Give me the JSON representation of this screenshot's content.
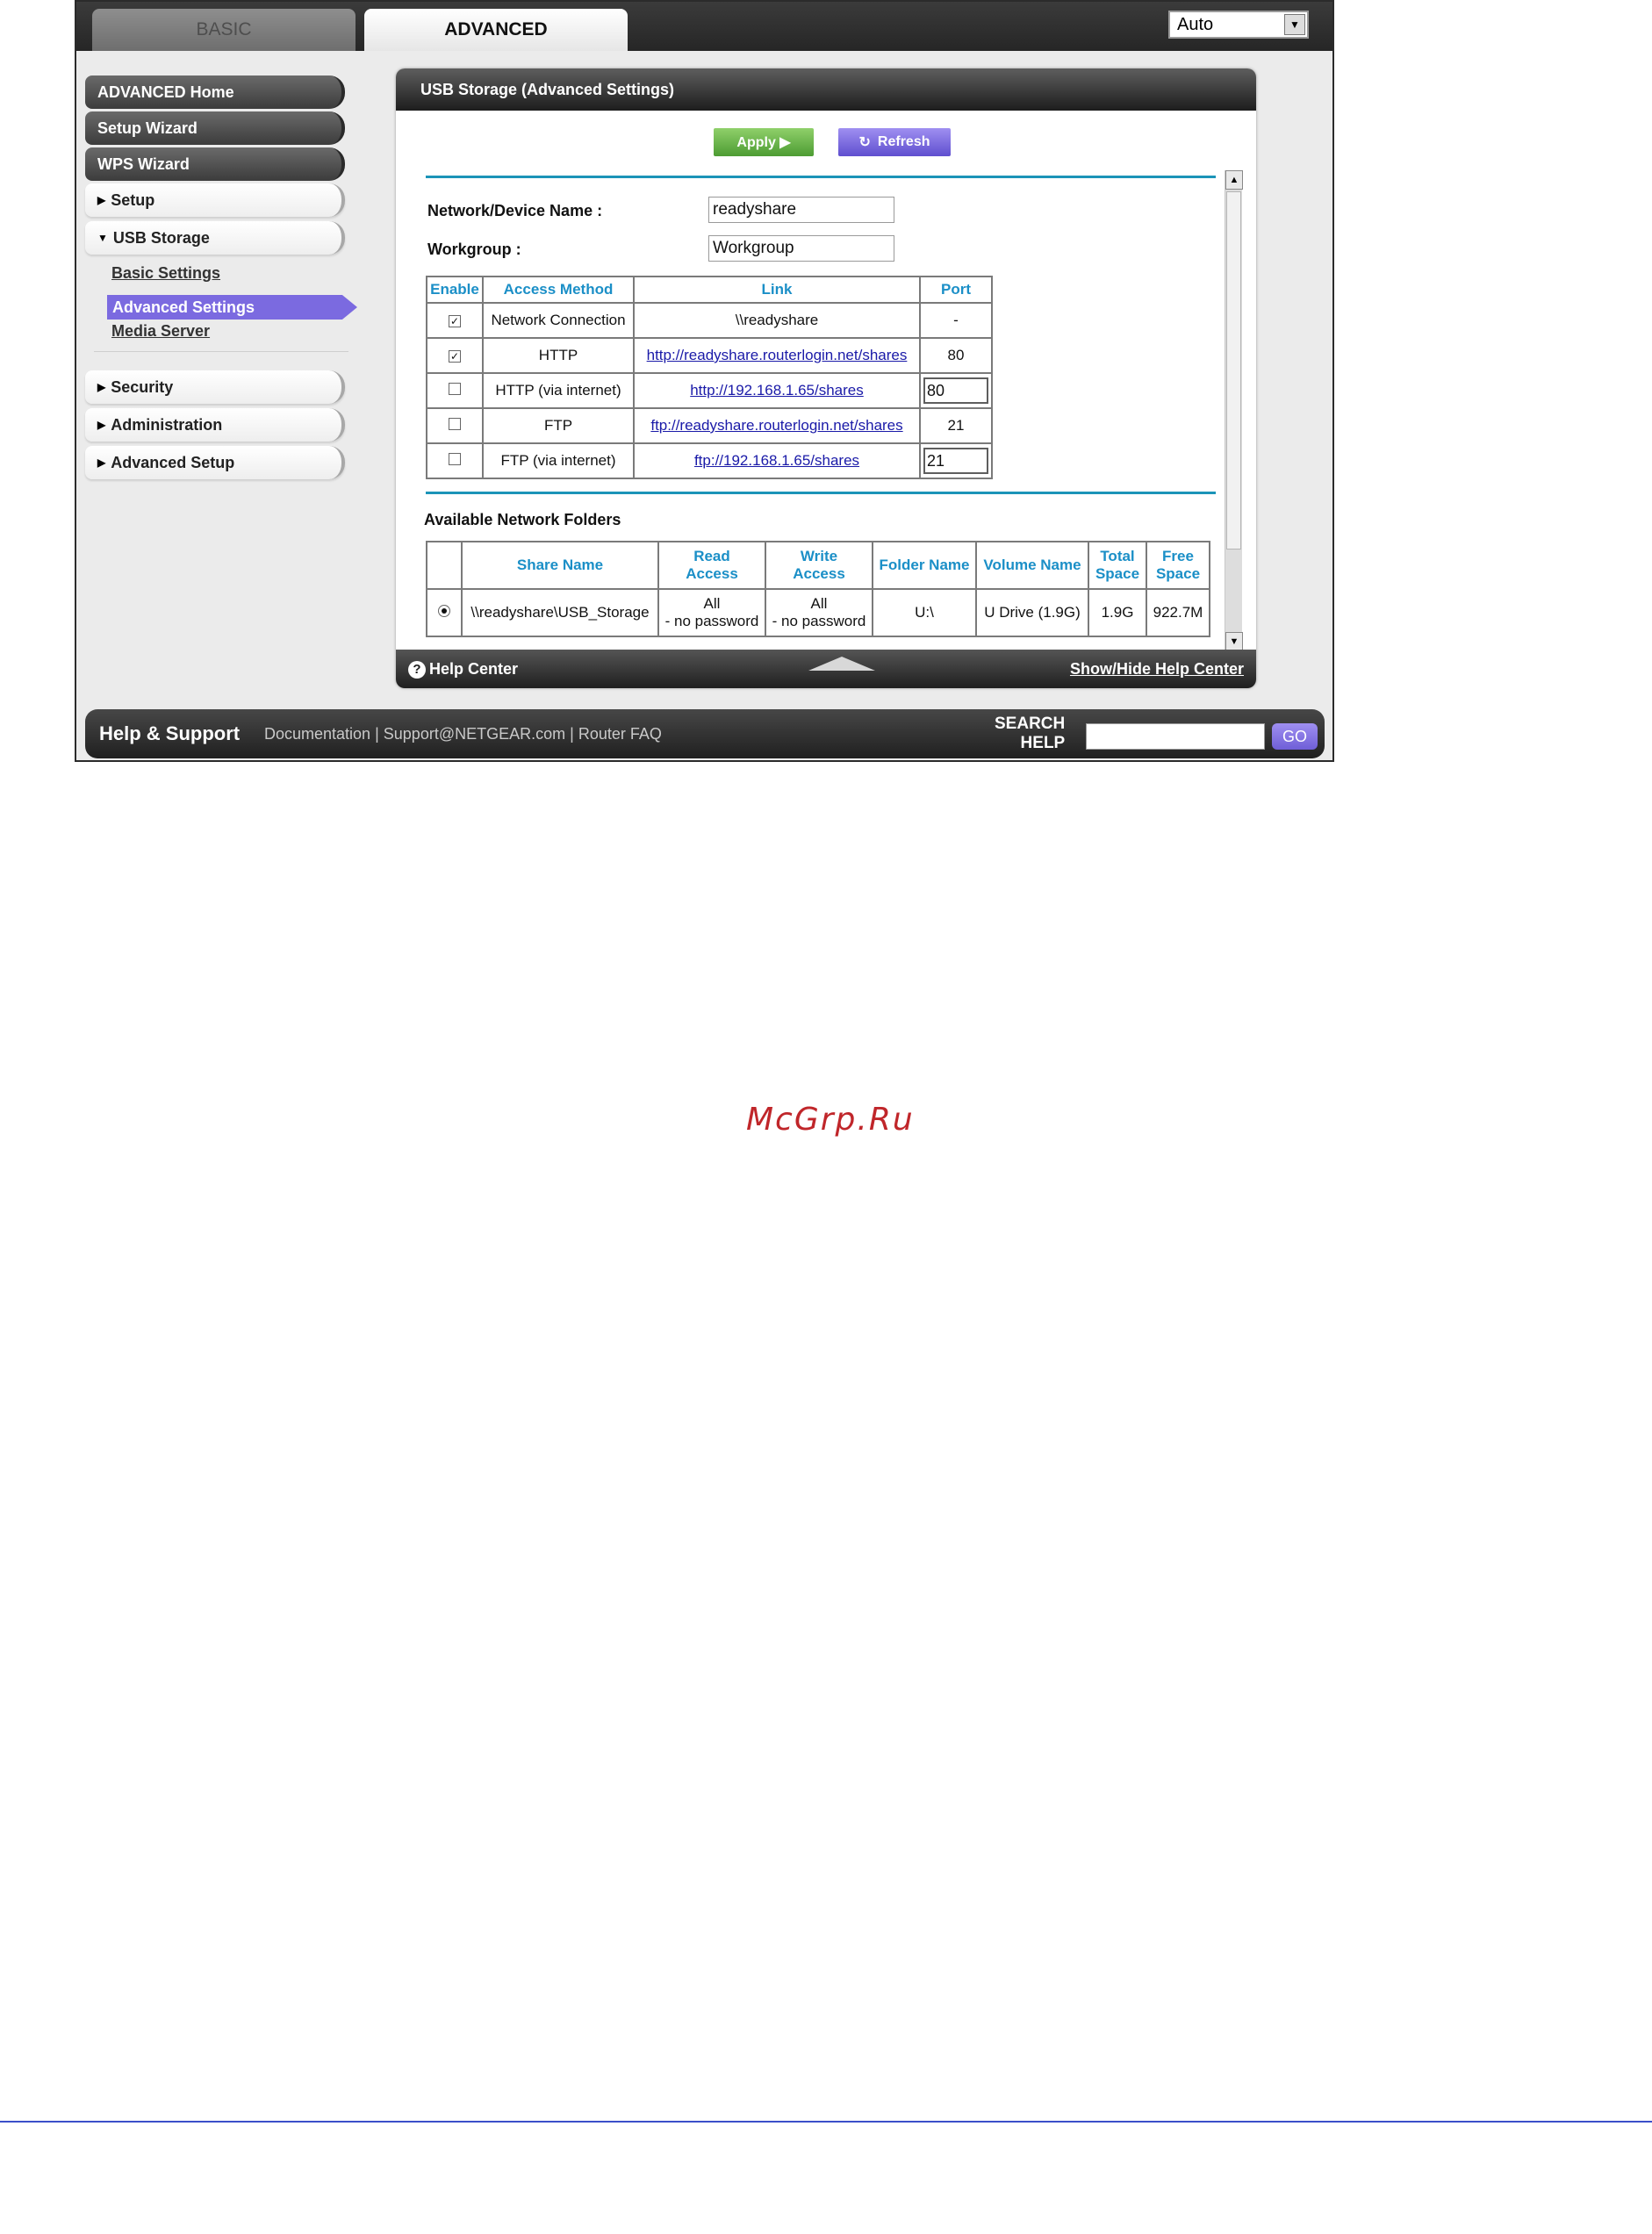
{
  "tabs": {
    "basic": "BASIC",
    "advanced": "ADVANCED"
  },
  "language_select": "Auto",
  "sidebar": {
    "dark_items": [
      "ADVANCED Home",
      "Setup Wizard",
      "WPS Wizard"
    ],
    "setup": "Setup",
    "usb_storage": "USB Storage",
    "usb_sub": [
      "Basic Settings",
      "Advanced Settings",
      "Media Server"
    ],
    "security": "Security",
    "administration": "Administration",
    "advanced_setup": "Advanced Setup"
  },
  "panel": {
    "title": "USB Storage (Advanced Settings)",
    "apply": "Apply ▶",
    "refresh": "Refresh",
    "device_name_label": "Network/Device Name :",
    "device_name_value": "readyshare",
    "workgroup_label": "Workgroup :",
    "workgroup_value": "Workgroup",
    "access_headers": [
      "Enable",
      "Access Method",
      "Link",
      "Port"
    ],
    "access_rows": [
      {
        "checked": true,
        "method": "Network Connection",
        "link": "\\\\readyshare",
        "link_is_url": false,
        "port": "-",
        "port_editable": false
      },
      {
        "checked": true,
        "method": "HTTP",
        "link": "http://readyshare.routerlogin.net/shares",
        "link_is_url": true,
        "port": "80",
        "port_editable": false
      },
      {
        "checked": false,
        "method": "HTTP (via internet)",
        "link": "http://192.168.1.65/shares",
        "link_is_url": true,
        "port": "80",
        "port_editable": true
      },
      {
        "checked": false,
        "method": "FTP",
        "link": "ftp://readyshare.routerlogin.net/shares",
        "link_is_url": true,
        "port": "21",
        "port_editable": false
      },
      {
        "checked": false,
        "method": "FTP (via internet)",
        "link": "ftp://192.168.1.65/shares",
        "link_is_url": true,
        "port": "21",
        "port_editable": true
      }
    ],
    "folders_title": "Available Network Folders",
    "folder_headers": {
      "share_name": "Share Name",
      "read_1": "Read",
      "read_2": "Access",
      "write_1": "Write",
      "write_2": "Access",
      "folder_name": "Folder Name",
      "volume_name": "Volume Name",
      "total_1": "Total",
      "total_2": "Space",
      "free_1": "Free",
      "free_2": "Space"
    },
    "folder_row": {
      "share_name": "\\\\readyshare\\USB_Storage",
      "read_1": "All",
      "read_2": "- no password",
      "write_1": "All",
      "write_2": "- no password",
      "folder_name": "U:\\",
      "volume_name": "U Drive (1.9G)",
      "total": "1.9G",
      "free": "922.7M"
    }
  },
  "help_bar": {
    "help_center": "Help Center",
    "toggle": "Show/Hide Help Center"
  },
  "footer": {
    "title": "Help & Support",
    "link_documentation": "Documentation",
    "link_support": "Support@NETGEAR.com",
    "link_faq": "Router FAQ",
    "search_line1": "SEARCH",
    "search_line2": "HELP",
    "go": "GO"
  },
  "watermark": "McGrp.Ru",
  "colors": {
    "accent_teal": "#1b94b8",
    "highlight_purple": "#7b6ae0",
    "apply_green": "#5aa83a",
    "watermark_red": "#c0262a"
  }
}
